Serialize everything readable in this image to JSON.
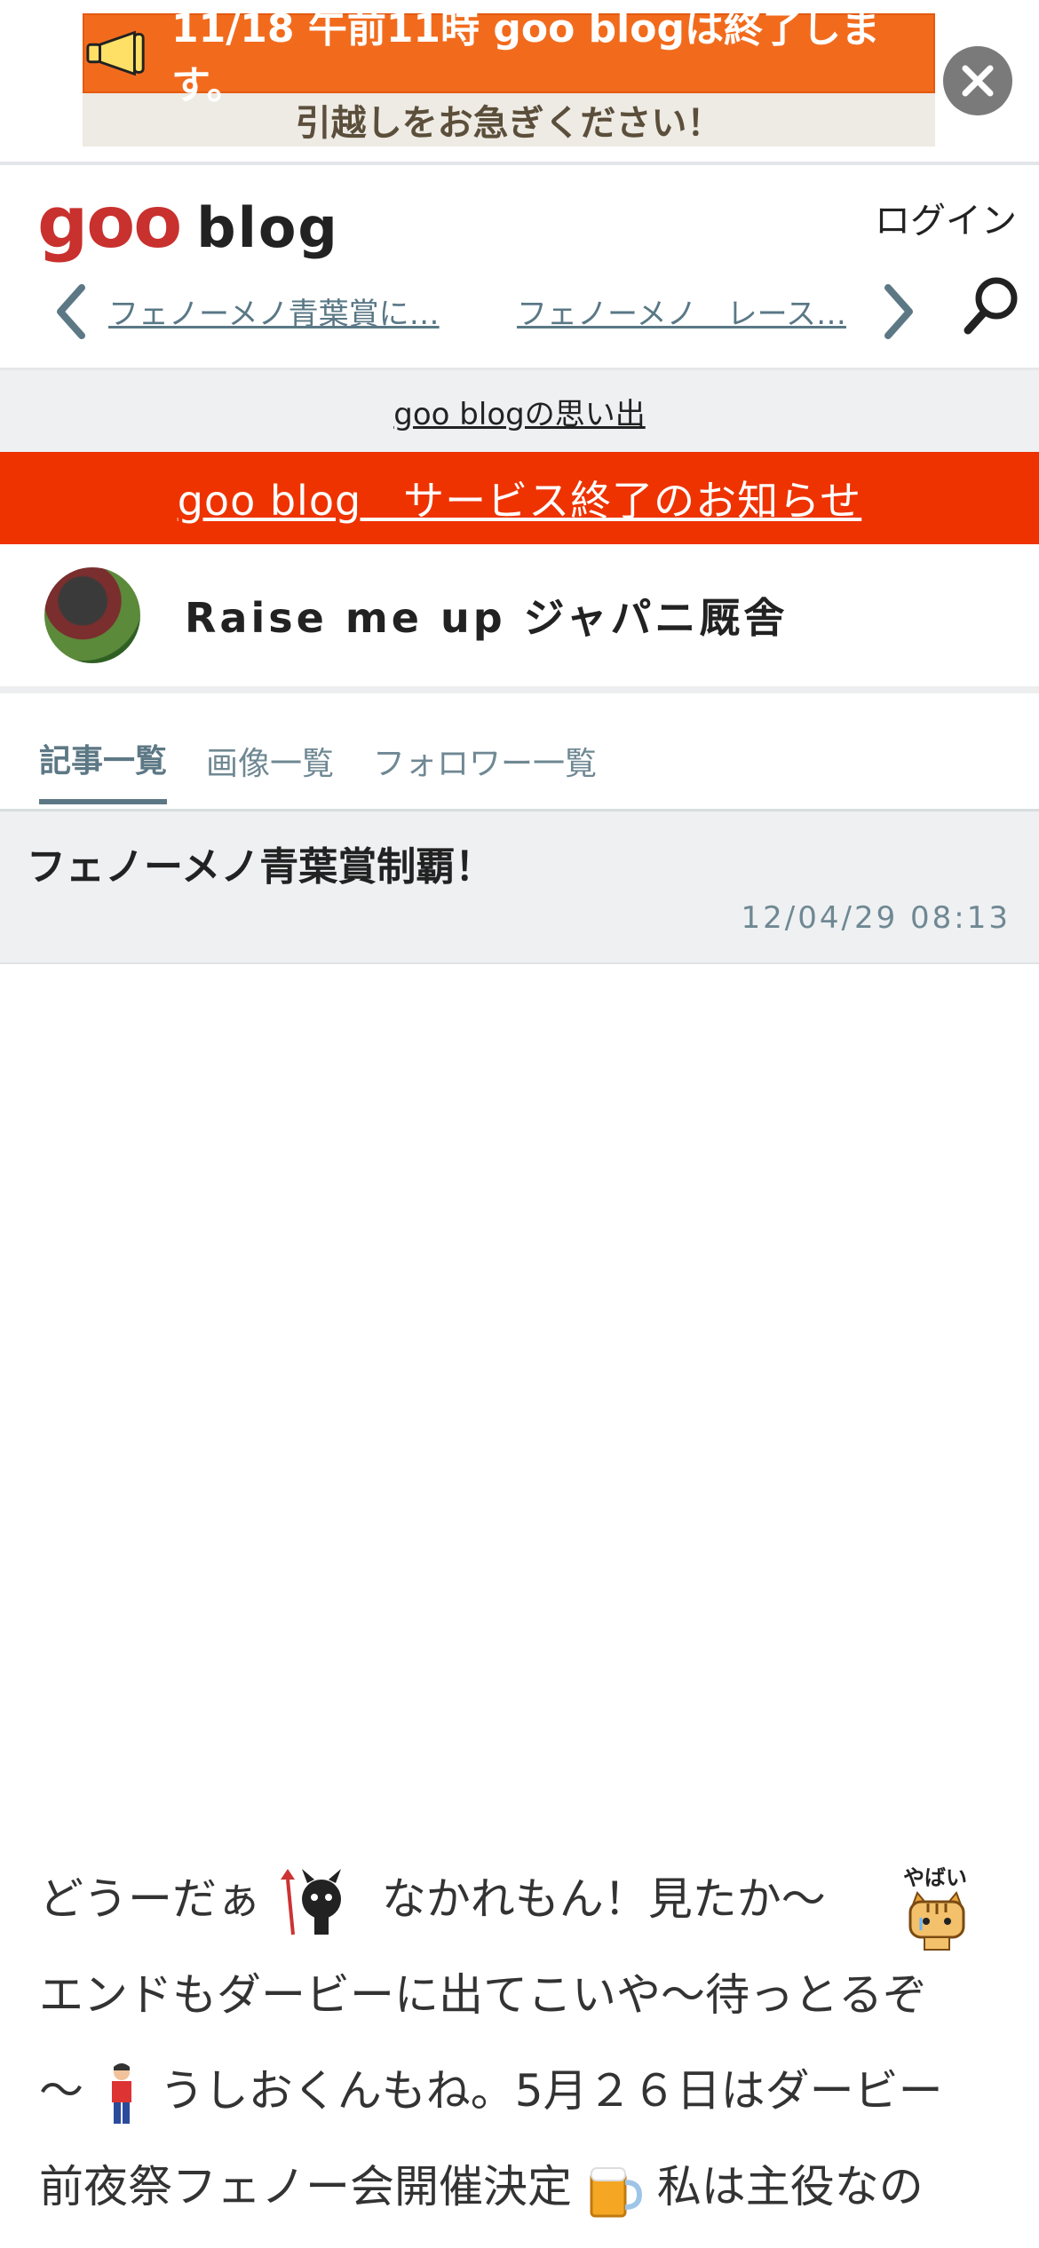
{
  "promo_banner": {
    "line1": "11/18 午前11時 goo blogは終了します。",
    "line2": "引越しをお急ぎください！"
  },
  "header": {
    "logo_goo": "goo",
    "logo_blog": "blog",
    "login_label": "ログイン",
    "prev_article": "フェノーメノ青葉賞に…",
    "next_article": "フェノーメノ　レース…"
  },
  "memory_link": "goo blogの思い出",
  "notice_link": "goo blog　サービス終了のお知らせ",
  "blog": {
    "title": "Raise me up ジャパニ厩舎"
  },
  "tabs": [
    "記事一覧",
    "画像一覧",
    "フォロワー一覧"
  ],
  "article": {
    "title": "フェノーメノ青葉賞制覇！",
    "date": "12/04/29 08:13",
    "lines": [
      [
        "どうーだぁ",
        "なかれもん！見たか～"
      ],
      [
        "エンドもダービーに出てこいや～待っとるぞ"
      ],
      [
        "～",
        "うしおくんもね。5月２６日はダービー"
      ],
      [
        "前夜祭フェノー会開催決定",
        "私は主役なの"
      ]
    ],
    "sticker_text": "やばい"
  }
}
